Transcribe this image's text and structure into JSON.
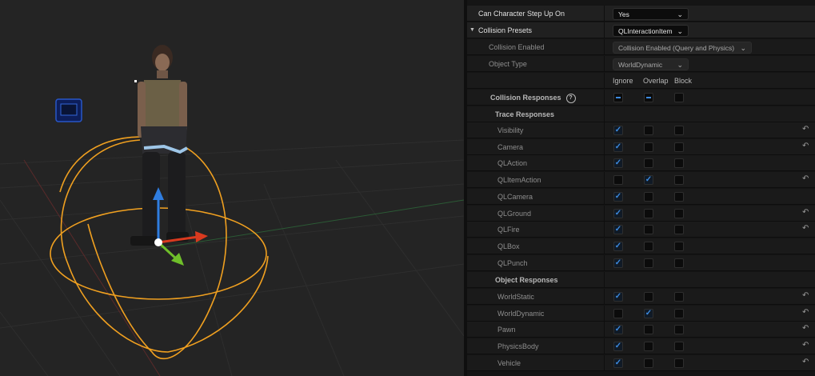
{
  "details": {
    "step_up": {
      "label": "Can Character Step Up On",
      "value": "Yes"
    },
    "presets": {
      "label": "Collision Presets",
      "value": "QLInteractionItem"
    },
    "enabled": {
      "label": "Collision Enabled",
      "value": "Collision Enabled (Query and Physics)"
    },
    "object_type": {
      "label": "Object Type",
      "value": "WorldDynamic"
    },
    "columns": {
      "ignore": "Ignore",
      "overlap": "Overlap",
      "block": "Block"
    },
    "responses_label": "Collision Responses",
    "help_glyph": "?",
    "trace_label": "Trace Responses",
    "object_label": "Object Responses",
    "trace": [
      {
        "name": "Visibility",
        "state": "ignore",
        "reset": true
      },
      {
        "name": "Camera",
        "state": "ignore",
        "reset": true
      },
      {
        "name": "QLAction",
        "state": "ignore",
        "reset": false
      },
      {
        "name": "QLItemAction",
        "state": "overlap",
        "reset": true
      },
      {
        "name": "QLCamera",
        "state": "ignore",
        "reset": false
      },
      {
        "name": "QLGround",
        "state": "ignore",
        "reset": true
      },
      {
        "name": "QLFire",
        "state": "ignore",
        "reset": true
      },
      {
        "name": "QLBox",
        "state": "ignore",
        "reset": false
      },
      {
        "name": "QLPunch",
        "state": "ignore",
        "reset": false
      }
    ],
    "objects": [
      {
        "name": "WorldStatic",
        "state": "ignore",
        "reset": true
      },
      {
        "name": "WorldDynamic",
        "state": "overlap",
        "reset": true
      },
      {
        "name": "Pawn",
        "state": "ignore",
        "reset": true
      },
      {
        "name": "PhysicsBody",
        "state": "ignore",
        "reset": true
      },
      {
        "name": "Vehicle",
        "state": "ignore",
        "reset": true
      }
    ]
  },
  "colors": {
    "gizmo_ring": "#f0a020",
    "axis_x": "#d93a1f",
    "axis_y": "#6fbf2a",
    "axis_z": "#2f7de0",
    "check": "#3d8be0"
  }
}
